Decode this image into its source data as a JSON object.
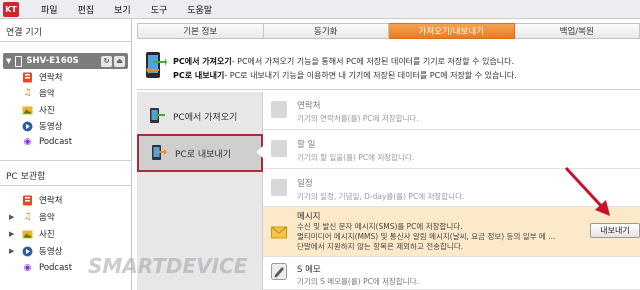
{
  "menubar": {
    "logo": "KT",
    "items": [
      "파일",
      "편집",
      "보기",
      "도구",
      "도움말"
    ]
  },
  "left": {
    "connected_title": "연결 기기",
    "device_name": "SHV-E160S",
    "device_items": [
      "연락처",
      "음악",
      "사진",
      "동영상",
      "Podcast"
    ],
    "storage_title": "PC 보관함",
    "storage_items": [
      "연락처",
      "음악",
      "사진",
      "동영상",
      "Podcast"
    ]
  },
  "tabs": [
    "기본 정보",
    "동기화",
    "가져오기/내보내기",
    "백업/복원"
  ],
  "active_tab": "가져오기/내보내기",
  "info": {
    "line1_bold": "PC에서 가져오기",
    "line1_rest": "- PC에서 가져오기 기능을 통해서 PC에 저장된 데이터를 기기로 저장할 수 있습니다.",
    "line2_bold": "PC로 내보내기",
    "line2_rest": "- PC로 내보내기 기능을 이용하면 내 기기에 저장된 데이터를 PC에 저장할 수 있습니다."
  },
  "mid": {
    "import_label": "PC에서 가져오기",
    "export_label": "PC로 내보내기"
  },
  "list": [
    {
      "title": "연락처",
      "desc": [
        "기기의 연락처를(를) PC에 저장합니다."
      ]
    },
    {
      "title": "할 일",
      "desc": [
        "기기의 할 일을(를) PC에 저장합니다."
      ]
    },
    {
      "title": "일정",
      "desc": [
        "기기의 일정, 기념일, D-day를(를) PC에 저장합니다."
      ]
    },
    {
      "title": "메시지",
      "desc": [
        "수신 및 발신 문자 메시지(SMS)를 PC에 저장합니다.",
        "멀티미디어 메시지(MMS) 및 통신사 알림 메시지(날씨, 요금 정보) 등의 일부 메 ...",
        "단말에서 지원하지 않는 항목은 제외하고 전송합니다."
      ]
    },
    {
      "title": "S 메모",
      "desc": [
        "기기의 S 메모를(를) PC에 저장합니다."
      ]
    }
  ],
  "export_button": "내보내기",
  "watermark": "SMARTDEVICE",
  "colors": {
    "accent_orange": "#ec7a20",
    "selection_border": "#a1303e",
    "arrow_red": "#c8102e"
  }
}
